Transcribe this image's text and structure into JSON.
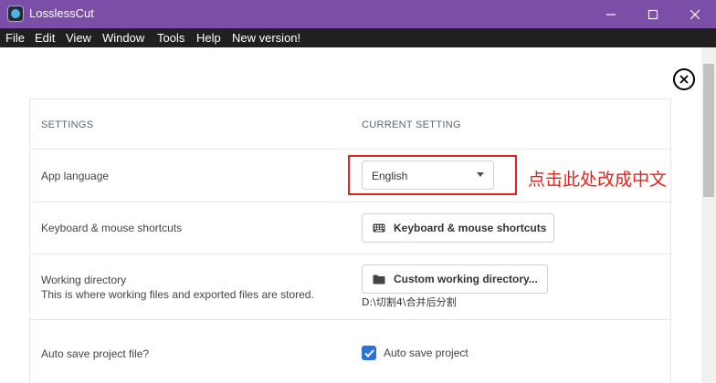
{
  "window": {
    "title": "LosslessCut",
    "controls": [
      "minimize-icon",
      "maximize-icon",
      "close-icon"
    ],
    "titlebar_color": "#7b4ea8"
  },
  "menu": {
    "items": [
      "File",
      "Edit",
      "View",
      "Window",
      "Tools",
      "Help",
      "New version!"
    ]
  },
  "settings": {
    "header_settings": "SETTINGS",
    "header_current": "CURRENT SETTING",
    "rows": {
      "language": {
        "label": "App language",
        "selected": "English"
      },
      "shortcuts": {
        "label": "Keyboard & mouse shortcuts",
        "button": "Keyboard & mouse shortcuts",
        "icon": "keyboard-icon"
      },
      "working_dir": {
        "label": "Working directory",
        "description": "This is where working files and exported files are stored.",
        "button": "Custom working directory...",
        "icon": "folder-icon",
        "path": "D:\\切割4\\合并后分割"
      },
      "autosave": {
        "label": "Auto save project file?",
        "checkbox_label": "Auto save project",
        "checked": true
      }
    }
  },
  "annotation": {
    "text": "点击此处改成中文",
    "color": "#e8211c"
  },
  "colors": {
    "accent": "#2d72d9"
  }
}
